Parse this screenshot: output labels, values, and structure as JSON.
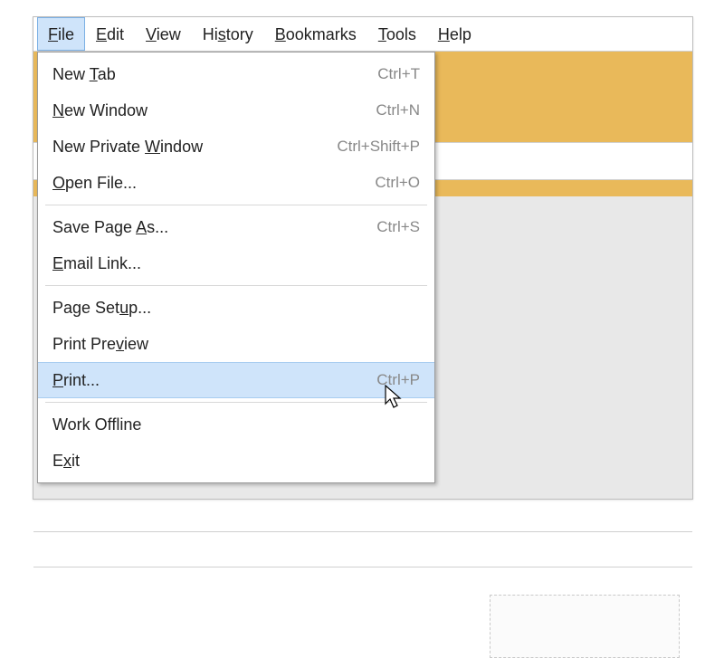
{
  "menubar": {
    "items": [
      {
        "pre": "",
        "mnemonic": "F",
        "post": "ile"
      },
      {
        "pre": "",
        "mnemonic": "E",
        "post": "dit"
      },
      {
        "pre": "",
        "mnemonic": "V",
        "post": "iew"
      },
      {
        "pre": "Hi",
        "mnemonic": "s",
        "post": "tory"
      },
      {
        "pre": "",
        "mnemonic": "B",
        "post": "ookmarks"
      },
      {
        "pre": "",
        "mnemonic": "T",
        "post": "ools"
      },
      {
        "pre": "",
        "mnemonic": "H",
        "post": "elp"
      }
    ]
  },
  "file_menu": {
    "items": [
      {
        "pre": "New ",
        "mnemonic": "T",
        "post": "ab",
        "shortcut": "Ctrl+T"
      },
      {
        "pre": "",
        "mnemonic": "N",
        "post": "ew Window",
        "shortcut": "Ctrl+N"
      },
      {
        "pre": "New Private ",
        "mnemonic": "W",
        "post": "indow",
        "shortcut": "Ctrl+Shift+P"
      },
      {
        "pre": "",
        "mnemonic": "O",
        "post": "pen File...",
        "shortcut": "Ctrl+O"
      },
      {
        "sep": true
      },
      {
        "pre": "Save Page ",
        "mnemonic": "A",
        "post": "s...",
        "shortcut": "Ctrl+S"
      },
      {
        "pre": "",
        "mnemonic": "E",
        "post": "mail Link...",
        "shortcut": ""
      },
      {
        "sep": true
      },
      {
        "pre": "Page Set",
        "mnemonic": "u",
        "post": "p...",
        "shortcut": ""
      },
      {
        "pre": "Print Pre",
        "mnemonic": "v",
        "post": "iew",
        "shortcut": ""
      },
      {
        "pre": "",
        "mnemonic": "P",
        "post": "rint...",
        "shortcut": "Ctrl+P",
        "highlight": true
      },
      {
        "sep": true
      },
      {
        "pre": "Work Offline",
        "mnemonic": "",
        "post": "",
        "shortcut": ""
      },
      {
        "pre": "E",
        "mnemonic": "x",
        "post": "it",
        "shortcut": ""
      }
    ]
  }
}
